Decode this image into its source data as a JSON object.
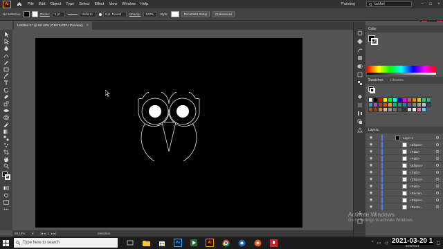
{
  "menubar": {
    "app_logo": "Ai",
    "items": [
      "File",
      "Edit",
      "Object",
      "Type",
      "Select",
      "Effect",
      "View",
      "Window",
      "Help"
    ],
    "workspace": "Painting",
    "search_value": "bucket"
  },
  "controlbar": {
    "selection": "No Selection",
    "stroke_label": "Stroke:",
    "stroke_weight": "1 pt",
    "profile": "Uniform",
    "brush": "5 pt. Round",
    "opacity_label": "Opacity:",
    "opacity_value": "100%",
    "style_label": "Style:",
    "doc_setup": "Document Setup",
    "preferences": "Preferences"
  },
  "document": {
    "tab_title": "Untitled-1* @ 69.18% (CMYK/GPU Preview)",
    "tab_close": "×"
  },
  "statusbar": {
    "zoom": "69.18%",
    "page": "1",
    "tool": "Selection"
  },
  "panels": {
    "color_title": "Color",
    "swatches_title": "Swatches",
    "libraries_title": "Libraries",
    "layers_title": "Layers",
    "layers": [
      {
        "name": "Layer 1",
        "thumb": "black"
      },
      {
        "name": "<Ellipse>",
        "thumb": "white"
      },
      {
        "name": "<Path>",
        "thumb": "white"
      },
      {
        "name": "<Path>",
        "thumb": "white"
      },
      {
        "name": "<Ellipse>",
        "thumb": "white"
      },
      {
        "name": "<Path>",
        "thumb": "white"
      },
      {
        "name": "<Ellipse>",
        "thumb": "white"
      },
      {
        "name": "<Path>",
        "thumb": "white"
      },
      {
        "name": "<Rectan...",
        "thumb": "white"
      },
      {
        "name": "<Ellipse>",
        "thumb": "white"
      },
      {
        "name": "<Recta...",
        "thumb": "white"
      }
    ]
  },
  "watermark": {
    "line1": "Activate Windows",
    "line2": "Go to Settings to activate Windows."
  },
  "taskbar": {
    "search_placeholder": "Type here to search",
    "clock_time": "2021-03-20 1",
    "clock_date": "3/20/2021"
  },
  "colors": {
    "accent": "#ff9a00",
    "artboard": "#000000",
    "ui_dark": "#323232",
    "ui_mid": "#424242",
    "ui_bg": "#535353"
  }
}
